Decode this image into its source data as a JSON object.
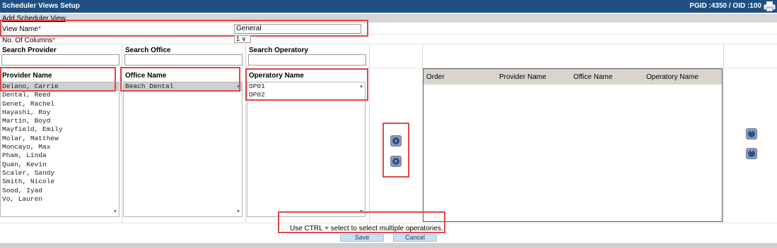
{
  "header": {
    "title": "Scheduler Views Setup",
    "ids": "PGID :4350  /  OID :100",
    "printer_icon": "printer-icon"
  },
  "section": {
    "title": "Add Scheduler View"
  },
  "form": {
    "view_name_label": "View Name",
    "required_mark": "*",
    "view_name_value": "General",
    "columns_label": "No. Of Columns",
    "columns_value": "1"
  },
  "search": {
    "provider_label": "Search Provider",
    "office_label": "Search Office",
    "operatory_label": "Search Operatory"
  },
  "lists": {
    "provider_header": "Provider Name",
    "office_header": "Office Name",
    "operatory_header": "Operatory Name",
    "providers": [
      "Delano, Carrie",
      "Dental, Reed",
      "Genet, Rachel",
      "Hayashi, Roy",
      "Martin, Boyd",
      "Mayfield, Emily",
      "Molar, Matthew",
      "Moncayo, Max",
      "Pham, Linda",
      "Quan, Kevin",
      "Scaler, Sandy",
      "Smith, Nicole",
      "Sood, Iyad",
      "Vo, Lauren"
    ],
    "offices": [
      "Beach Dental"
    ],
    "operatories": [
      "OP01",
      "OP02"
    ]
  },
  "grid": {
    "columns": [
      "Order",
      "Provider Name",
      "Office Name",
      "Operatory Name"
    ]
  },
  "footer": {
    "hint": "Use CTRL + select to select multiple operatories.",
    "save_label": "Save",
    "cancel_label": "Cancel"
  }
}
